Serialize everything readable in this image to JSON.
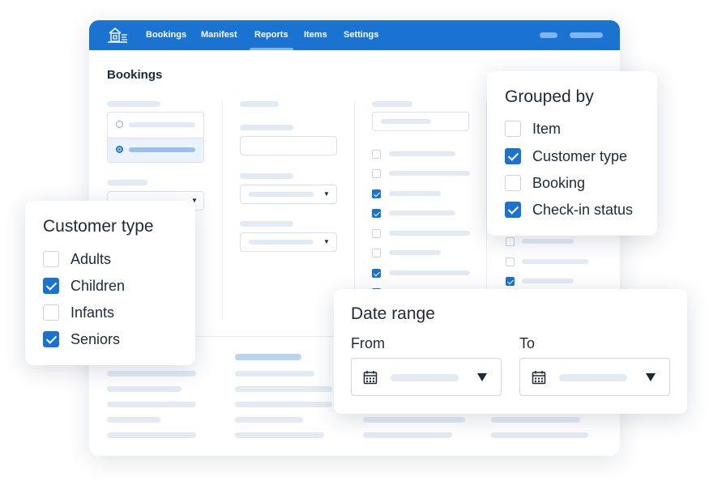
{
  "nav": {
    "items": [
      {
        "label": "Bookings",
        "active": false
      },
      {
        "label": "Manifest",
        "active": false
      },
      {
        "label": "Reports",
        "active": true
      },
      {
        "label": "Items",
        "active": false
      },
      {
        "label": "Settings",
        "active": false
      }
    ],
    "logo_icon": "house-logo-icon",
    "accent_color": "#1a73d0"
  },
  "page": {
    "title": "Bookings"
  },
  "grouped_by": {
    "title": "Grouped by",
    "options": [
      {
        "label": "Item",
        "checked": false
      },
      {
        "label": "Customer type",
        "checked": true
      },
      {
        "label": "Booking",
        "checked": false
      },
      {
        "label": "Check-in status",
        "checked": true
      }
    ]
  },
  "customer_type": {
    "title": "Customer type",
    "options": [
      {
        "label": "Adults",
        "checked": false
      },
      {
        "label": "Children",
        "checked": true
      },
      {
        "label": "Infants",
        "checked": false
      },
      {
        "label": "Seniors",
        "checked": true
      }
    ]
  },
  "date_range": {
    "title": "Date range",
    "from_label": "From",
    "to_label": "To",
    "calendar_icon": "calendar-icon",
    "dropdown_icon": "caret-down-icon"
  }
}
